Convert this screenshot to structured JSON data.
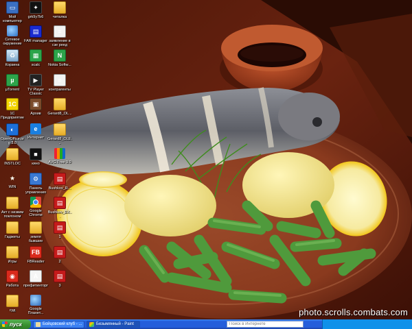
{
  "desktop": {
    "icons": [
      {
        "label": "Мой компьютер",
        "icon": "computer-icon"
      },
      {
        "label": "Сетевое окружение",
        "icon": "network-icon"
      },
      {
        "label": "Корзина",
        "icon": "recycle-bin-icon"
      },
      {
        "label": "µTorrent",
        "icon": "utorrent-icon"
      },
      {
        "label": "1С Предприятие",
        "icon": "1c-icon"
      },
      {
        "label": "OpenOffice.org 3.0",
        "icon": "openoffice-icon"
      },
      {
        "label": "INSTLOC",
        "icon": "folder-icon"
      },
      {
        "label": "WIN",
        "icon": "star-icon"
      },
      {
        "label": "Акт с низким поклоном",
        "icon": "folder-icon"
      },
      {
        "label": "Гаджеты",
        "icon": "folder-icon"
      },
      {
        "label": "Игры",
        "icon": "folder-icon"
      },
      {
        "label": "Работа",
        "icon": "red-app-icon"
      },
      {
        "label": "суд",
        "icon": "folder-icon"
      },
      {
        "label": "grk9y7b6",
        "icon": "app-icon"
      },
      {
        "label": "FAR manager",
        "icon": "far-icon"
      },
      {
        "label": "scalc",
        "icon": "calc-icon"
      },
      {
        "label": "TV Player Classic",
        "icon": "tv-icon"
      },
      {
        "label": "Архив",
        "icon": "archive-icon"
      },
      {
        "label": "Интернет",
        "icon": "ie-icon"
      },
      {
        "label": "кино",
        "icon": "movie-icon"
      },
      {
        "label": "Панель управления",
        "icon": "control-panel-icon"
      },
      {
        "label": "Google Chrome",
        "icon": "chrome-icon"
      },
      {
        "label": "земля бывшие",
        "icon": "folder-icon"
      },
      {
        "label": "FBReader",
        "icon": "fbreader-icon"
      },
      {
        "label": "префитинторг",
        "icon": "abbyy-icon"
      },
      {
        "label": "Google Планет...",
        "icon": "google-earth-icon"
      },
      {
        "label": "читалка",
        "icon": "folder-icon"
      },
      {
        "label": "заявление в сзе реед",
        "icon": "document-icon"
      },
      {
        "label": "Nokia Softw...",
        "icon": "nokia-icon"
      },
      {
        "label": "контрагенты",
        "icon": "document-icon"
      },
      {
        "label": "Gerard8_OL...",
        "icon": "folder-icon"
      },
      {
        "label": "Gerard8_OLE...",
        "icon": "folder-icon"
      },
      {
        "label": "AVG Free 9.0",
        "icon": "avg-icon"
      },
      {
        "label": "Bushkov_R...",
        "icon": "pdf-icon"
      },
      {
        "label": "Bushkov_EX...",
        "icon": "pdf-icon"
      },
      {
        "label": "1",
        "icon": "pdf-icon"
      },
      {
        "label": "2",
        "icon": "pdf-icon"
      },
      {
        "label": "3",
        "icon": "pdf-icon"
      }
    ]
  },
  "watermark": "photo.scrolls.combats.com",
  "taskbar": {
    "start_label": "пуск",
    "buttons": [
      {
        "label": "Бойцовский клуб - ..."
      },
      {
        "label": "Безымянный - Paint"
      }
    ],
    "search_placeholder": "Поиск в Интернете"
  }
}
